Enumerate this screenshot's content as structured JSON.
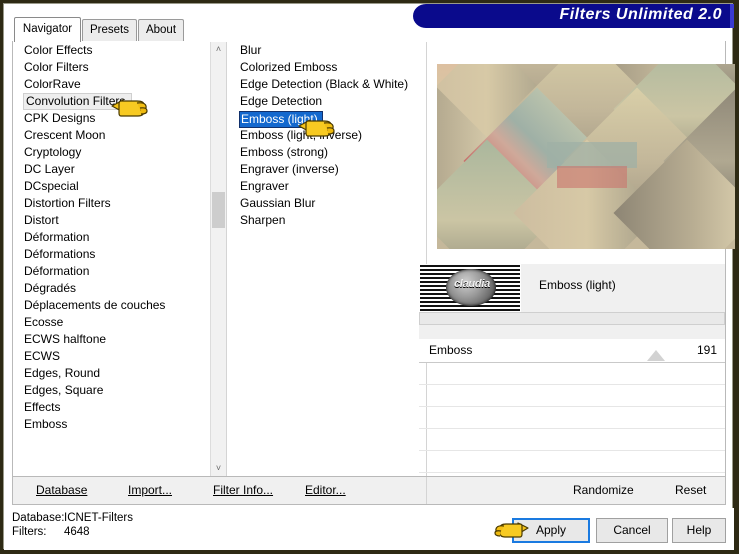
{
  "window": {
    "title": "Filters Unlimited 2.0",
    "accent_navy": "#0a0a8c",
    "selection_blue": "#1368ce",
    "frame_color": "#2e2a14"
  },
  "tabs": [
    {
      "label": "Navigator",
      "active": true
    },
    {
      "label": "Presets",
      "active": false
    },
    {
      "label": "About",
      "active": false
    }
  ],
  "category_list": {
    "selected": "Convolution Filters",
    "items": [
      "Color Effects",
      "Color Filters",
      "ColorRave",
      "Convolution Filters",
      "CPK Designs",
      "Crescent Moon",
      "Cryptology",
      "DC Layer",
      "DCspecial",
      "Distortion Filters",
      "Distort",
      "Déformation",
      "Déformations",
      "Déformation",
      "Dégradés",
      "Déplacements de couches",
      "Ecosse",
      "ECWS halftone",
      "ECWS",
      "Edges, Round",
      "Edges, Square",
      "Effects",
      "Emboss"
    ]
  },
  "effect_list": {
    "selected": "Emboss (light)",
    "items": [
      "Blur",
      "Colorized Emboss",
      "Edge Detection (Black & White)",
      "Edge Detection",
      "Emboss (light)",
      "Emboss (light, inverse)",
      "Emboss (strong)",
      "Engraver (inverse)",
      "Engraver",
      "Gaussian Blur",
      "Sharpen"
    ]
  },
  "preview": {
    "thumbnail_word": "claudia",
    "filter_name": "Emboss (light)"
  },
  "parameters": [
    {
      "label": "Emboss",
      "value": "191"
    }
  ],
  "toolbar": {
    "database_label": "Database",
    "import_label": "Import...",
    "filter_info_label": "Filter Info...",
    "editor_label": "Editor...",
    "randomize_label": "Randomize",
    "reset_label": "Reset"
  },
  "status": {
    "database_key": "Database:",
    "database_value": "ICNET-Filters",
    "filters_key": "Filters:",
    "filters_value": "4648"
  },
  "buttons": {
    "apply_label": "Apply",
    "cancel_label": "Cancel",
    "help_label": "Help"
  },
  "icons": {
    "scroll_up": "˄",
    "scroll_down": "˅"
  }
}
